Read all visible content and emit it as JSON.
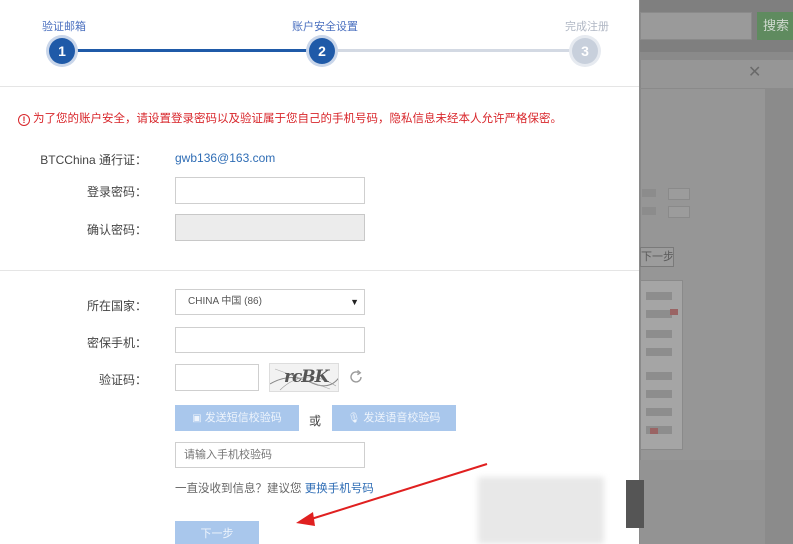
{
  "background": {
    "search_button_label": "搜索",
    "next_button_label": "下一步"
  },
  "steps": [
    {
      "label": "验证邮箱",
      "number": "1",
      "state": "done"
    },
    {
      "label": "账户安全设置",
      "number": "2",
      "state": "current"
    },
    {
      "label": "完成注册",
      "number": "3",
      "state": "pending"
    }
  ],
  "notice": {
    "icon": "!",
    "text": "为了您的账户安全，请设置登录密码以及验证属于您自己的手机号码，隐私信息未经本人允许严格保密。"
  },
  "account": {
    "passport_label": "BTCChina 通行证：",
    "email": "gwb136@163.com",
    "login_password_label": "登录密码：",
    "confirm_password_label": "确认密码："
  },
  "phone": {
    "country_label": "所在国家：",
    "country_value": "CHINA 中国 (86)",
    "phone_label": "密保手机：",
    "captcha_label": "验证码：",
    "captcha_image_text": "rcBK",
    "sms_button": "发送短信校验码",
    "or": "或",
    "voice_button": "发送语音校验码",
    "sms_code_placeholder": "请输入手机校验码",
    "help_prefix": "一直没收到信息？建议您 ",
    "help_link": "更换手机号码",
    "next_button": "下一步"
  },
  "colors": {
    "primary": "#1f5aa8",
    "disabled_button": "#a9c7ec",
    "notice_red": "#d8262b",
    "link_blue": "#2f6db5",
    "annotation_arrow": "#e02020"
  }
}
